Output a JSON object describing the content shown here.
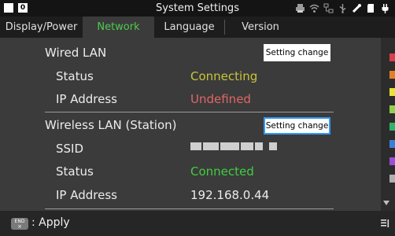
{
  "header": {
    "page_number": "0",
    "title": "System Settings",
    "status_icons": [
      "printer-icon",
      "wifi-icon",
      "lan-icon",
      "usb-icon",
      "probe-icon",
      "sd-card-icon",
      "power-plug-icon"
    ]
  },
  "tabs": [
    {
      "label": "Display/Power",
      "active": false
    },
    {
      "label": "Network",
      "active": true
    },
    {
      "label": "Language",
      "active": false
    },
    {
      "label": "Version",
      "active": false
    }
  ],
  "wired": {
    "title": "Wired LAN",
    "button_label": "Setting change",
    "status_label": "Status",
    "status_value": "Connecting",
    "status_color": "#c9c43a",
    "ip_label": "IP Address",
    "ip_value": "Undefined",
    "ip_color": "#e06666"
  },
  "wireless": {
    "title": "Wireless LAN (Station)",
    "button_label": "Setting change",
    "ssid_label": "SSID",
    "status_label": "Status",
    "status_value": "Connected",
    "status_color": "#3fcf3f",
    "ip_label": "IP Address",
    "ip_value": "192.168.0.44"
  },
  "footer": {
    "key_top": "END",
    "key_bottom": "×",
    "action": ": Apply"
  },
  "colors": {
    "accent_tab": "#4ecb4e",
    "focus_border": "#3399ff",
    "channel_swatches": [
      "#d6404a",
      "#e0802a",
      "#e8e23a",
      "#8fd14f",
      "#2fb36a",
      "#3a7fd6",
      "#9a4fd6",
      "#b0b0b0"
    ]
  }
}
